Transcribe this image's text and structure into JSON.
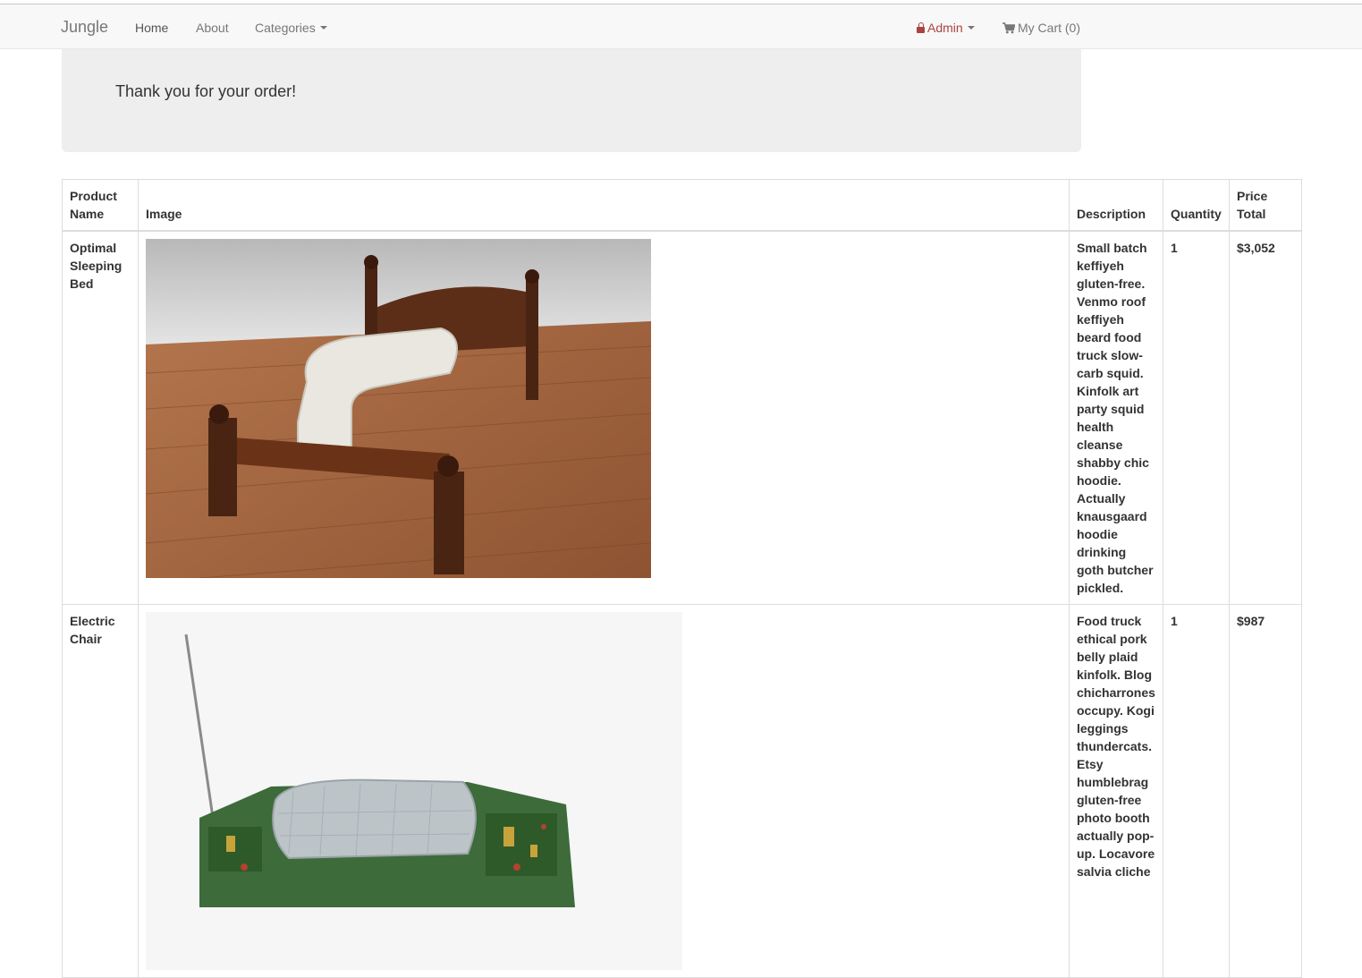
{
  "navbar": {
    "brand": "Jungle",
    "home_label": "Home",
    "about_label": "About",
    "categories_label": "Categories",
    "admin_label": "Admin",
    "cart_label": "My Cart (0)"
  },
  "jumbotron": {
    "message": "Thank you for your order!"
  },
  "table": {
    "headers": {
      "product_name": "Product Name",
      "image": "Image",
      "description": "Description",
      "quantity": "Quantity",
      "price_total": "Price Total"
    },
    "rows": [
      {
        "name": "Optimal Sleeping Bed",
        "image_alt": "bed",
        "description": "Small batch keffiyeh gluten-free. Venmo roof keffiyeh beard food truck slow-carb squid. Kinfolk art party squid health cleanse shabby chic hoodie. Actually knausgaard hoodie drinking goth butcher pickled.",
        "quantity": "1",
        "price_total": "$3,052"
      },
      {
        "name": "Electric Chair",
        "image_alt": "chair",
        "description": "Food truck ethical pork belly plaid kinfolk. Blog chicharrones occupy. Kogi leggings thundercats. Etsy humblebrag gluten-free photo booth actually pop-up. Locavore salvia cliche",
        "quantity": "1",
        "price_total": "$987"
      }
    ]
  },
  "colors": {
    "navbar_bg": "#f8f8f8",
    "jumbotron_bg": "#eeeeee",
    "admin_accent": "#a94442"
  }
}
